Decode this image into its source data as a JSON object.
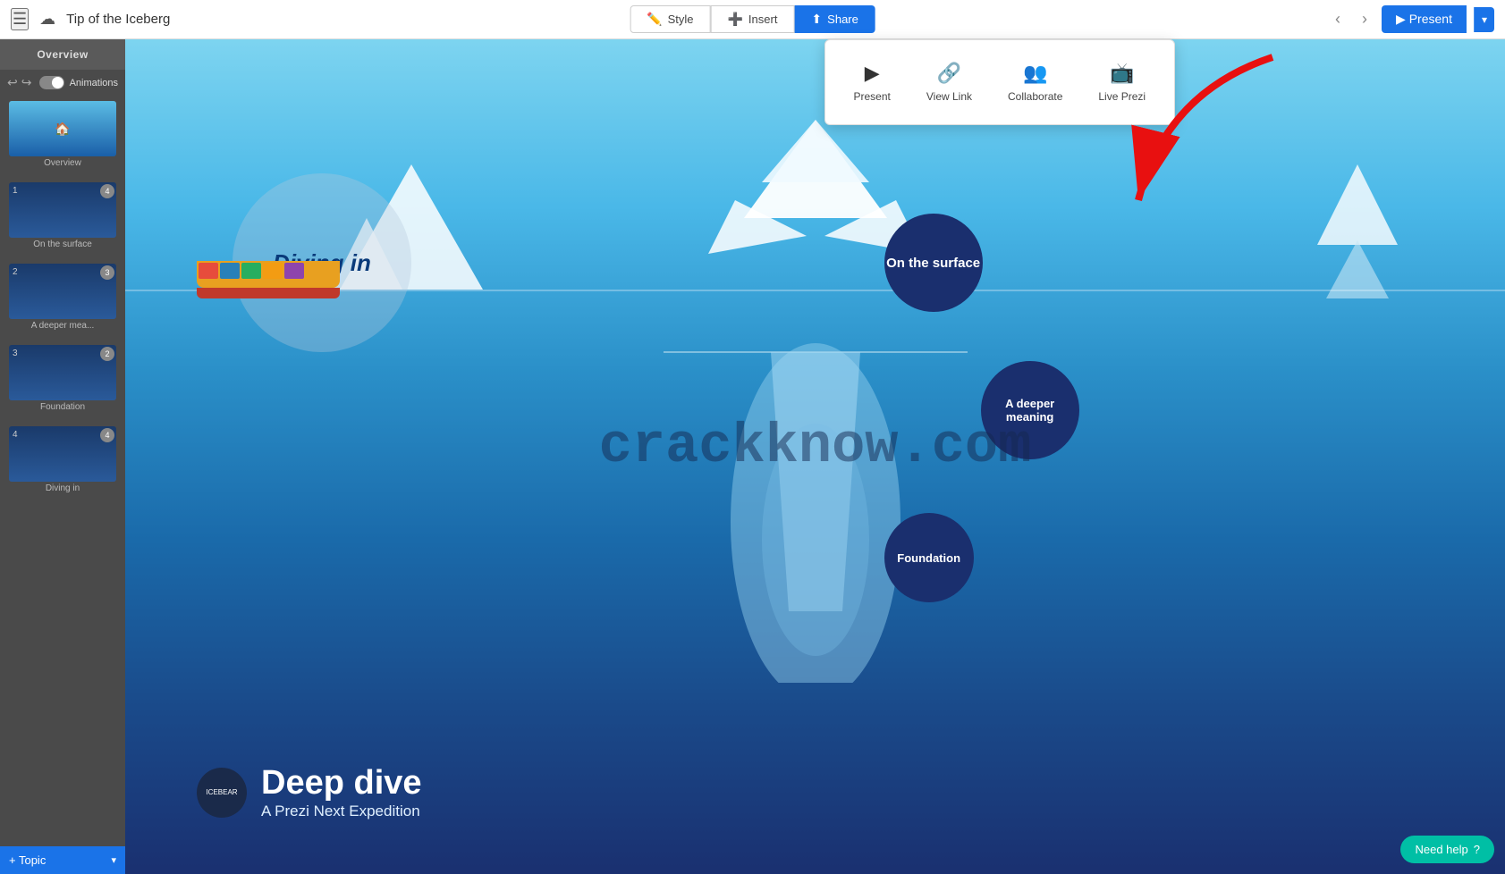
{
  "app": {
    "title": "Tip of the Iceberg"
  },
  "topbar": {
    "style_label": "Style",
    "insert_label": "Insert",
    "share_label": "Share",
    "present_label": "Present",
    "animations_label": "Animations"
  },
  "share_dropdown": {
    "present_label": "Present",
    "view_link_label": "View Link",
    "collaborate_label": "Collaborate",
    "live_prezi_label": "Live Prezi"
  },
  "sidebar": {
    "header_label": "Overview",
    "slides": [
      {
        "number": "",
        "label": "Overview",
        "badge": ""
      },
      {
        "number": "1",
        "label": "On the surface",
        "badge": "4"
      },
      {
        "number": "2",
        "label": "A deeper mea...",
        "badge": "3"
      },
      {
        "number": "3",
        "label": "Foundation",
        "badge": "2"
      },
      {
        "number": "4",
        "label": "Diving in",
        "badge": "4"
      }
    ]
  },
  "canvas": {
    "on_surface_label": "On the surface",
    "deeper_meaning_label": "A deeper meaning",
    "foundation_label": "Foundation",
    "diving_in_label": "Diving in",
    "watermark": "crackknow.com",
    "deep_dive_title": "Deep dive",
    "deep_dive_subtitle": "A Prezi Next Expedition",
    "logo_text": "ICEBEAR"
  },
  "bottom_bar": {
    "add_label": "+ Topic",
    "topic_label": "Topic"
  },
  "need_help": {
    "label": "Need help"
  }
}
